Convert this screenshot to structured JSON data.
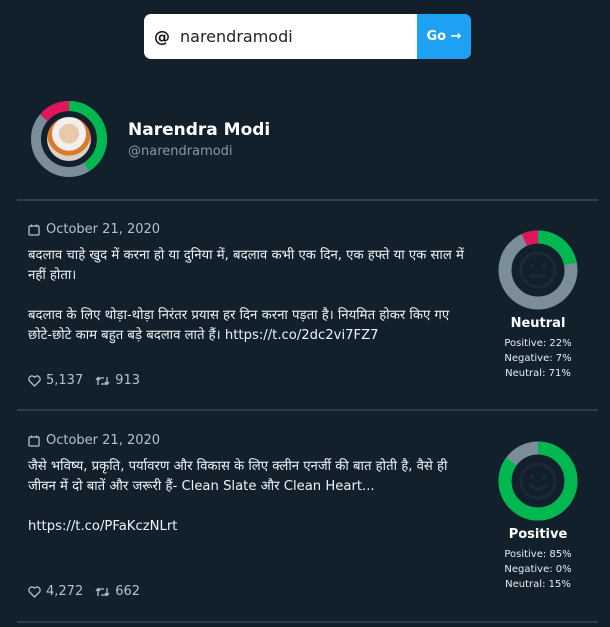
{
  "search": {
    "prefix": "@",
    "value": "narendramodi",
    "button_label": "Go →"
  },
  "profile": {
    "name": "Narendra Modi",
    "handle": "@narendramodi",
    "sentiment_ring": {
      "positive": 0.41,
      "negative": 0.14,
      "neutral": 0.45
    }
  },
  "colors": {
    "background": "#12202c",
    "positive": "#00b84f",
    "negative": "#e0155c",
    "neutral": "#7b8d98",
    "button": "#1ea1f2"
  },
  "tweets": [
    {
      "date": "October 21, 2020",
      "text": "बदलाव चाहे खुद में करना हो या दुनिया में, बदलाव कभी एक दिन, एक हफ्ते या एक साल में नहीं होता।\n\nबदलाव के लिए थोड़ा-थोड़ा निरंतर प्रयास हर दिन करना पड़ता है। नियमित होकर किए गए छोटे-छोटे काम बहुत बड़े बदलाव लाते हैं। https://t.co/2dc2vi7FZ7",
      "likes": "5,137",
      "retweets": "913",
      "sentiment": {
        "label": "Neutral",
        "face": "neutral-face-icon",
        "positive": 22,
        "negative": 7,
        "neutral": 71,
        "positive_text": "Positive: 22%",
        "negative_text": "Negative: 7%",
        "neutral_text": "Neutral: 71%"
      }
    },
    {
      "date": "October 21, 2020",
      "text": "जैसे भविष्य, प्रकृति, पर्यावरण और विकास के लिए क्लीन एनर्जी की बात होती है, वैसे ही जीवन में दो बातें और जरूरी हैं- Clean Slate और Clean Heart...\n\nhttps://t.co/PFaKczNLrt",
      "likes": "4,272",
      "retweets": "662",
      "sentiment": {
        "label": "Positive",
        "face": "smiling-face-icon",
        "positive": 85,
        "negative": 0,
        "neutral": 15,
        "positive_text": "Positive: 85%",
        "negative_text": "Negative: 0%",
        "neutral_text": "Neutral: 15%"
      }
    }
  ]
}
